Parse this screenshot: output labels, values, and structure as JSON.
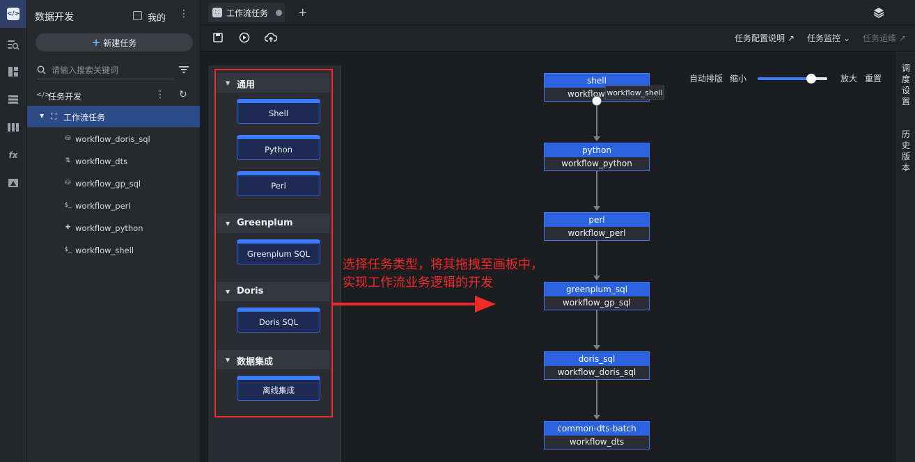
{
  "sidebar": {
    "title": "数据开发",
    "mine_label": "我的",
    "new_task": "新建任务",
    "search_placeholder": "请输入搜索关键词",
    "tree_root": "任务开发",
    "folder": "工作流任务",
    "files": [
      {
        "name": "workflow_doris_sql",
        "icon": "database-icon"
      },
      {
        "name": "workflow_dts",
        "icon": "sync-icon"
      },
      {
        "name": "workflow_gp_sql",
        "icon": "database-icon"
      },
      {
        "name": "workflow_perl",
        "icon": "terminal-icon"
      },
      {
        "name": "workflow_python",
        "icon": "python-icon"
      },
      {
        "name": "workflow_shell",
        "icon": "terminal-icon"
      }
    ]
  },
  "tabs": [
    {
      "label": "工作流任务",
      "unsaved": true
    }
  ],
  "toolbar": {
    "links": [
      "任务配置说明 ↗",
      "任务监控 ⌄",
      "任务运维 ↗"
    ]
  },
  "palette": {
    "categories": [
      {
        "label": "通用",
        "items": [
          "Shell",
          "Python",
          "Perl"
        ]
      },
      {
        "label": "Greenplum",
        "items": [
          "Greenplum SQL"
        ]
      },
      {
        "label": "Doris",
        "items": [
          "Doris SQL"
        ]
      },
      {
        "label": "数据集成",
        "items": [
          "离线集成"
        ]
      }
    ]
  },
  "annotation": {
    "line1": "选择任务类型，将其拖拽至画板中，",
    "line2": "实现工作流业务逻辑的开发"
  },
  "zoom": {
    "auto_layout": "自动排版",
    "zoom_out": "缩小",
    "zoom_in": "放大",
    "reset": "重置",
    "level": 0.78
  },
  "flow": {
    "nodes": [
      {
        "type": "shell",
        "name": "workflow_"
      },
      {
        "type": "python",
        "name": "workflow_python"
      },
      {
        "type": "perl",
        "name": "workflow_perl"
      },
      {
        "type": "greenplum_sql",
        "name": "workflow_gp_sql"
      },
      {
        "type": "doris_sql",
        "name": "workflow_doris_sql"
      },
      {
        "type": "common-dts-batch",
        "name": "workflow_dts"
      }
    ],
    "tooltip": "workflow_shell"
  },
  "right_rail": [
    "调度设置",
    "历史版本"
  ],
  "colors": {
    "accent": "#3b7bff",
    "annotation": "#ee2a2a",
    "node_header": "#2a62e0"
  }
}
